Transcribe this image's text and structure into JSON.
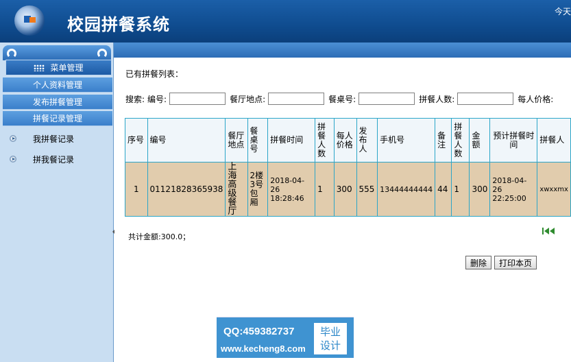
{
  "header": {
    "title": "校园拼餐系统",
    "today_label": "今天"
  },
  "sidebar": {
    "menu_title": "菜单管理",
    "sub_items": [
      "个人资料管理",
      "发布拼餐管理",
      "拼餐记录管理"
    ],
    "nav_items": [
      "我拼餐记录",
      "拼我餐记录"
    ]
  },
  "main": {
    "list_title": "已有拼餐列表：",
    "search": {
      "label": "搜索:",
      "fields": [
        {
          "label": "编号:",
          "value": ""
        },
        {
          "label": "餐厅地点:",
          "value": ""
        },
        {
          "label": "餐桌号:",
          "value": ""
        },
        {
          "label": "拼餐人数:",
          "value": ""
        },
        {
          "label": "每人价格:",
          "value": ""
        }
      ]
    },
    "table": {
      "headers": [
        "序号",
        "编号",
        "餐厅地点",
        "餐桌号",
        "拼餐时间",
        "拼餐人数",
        "每人价格",
        "发布人",
        "手机号",
        "备注",
        "拼餐人数",
        "金额",
        "预计拼餐时间",
        "拼餐人"
      ],
      "rows": [
        [
          "1",
          "01121828365938",
          "上海高级餐厅",
          "2楼3号包厢",
          "2018-04-26 18:28:46",
          "1",
          "300",
          "555",
          "13444444444",
          "44",
          "1",
          "300",
          "2018-04-26 22:25:00",
          "xwxxmx"
        ]
      ]
    },
    "total": "共计金额:300.0；",
    "buttons": {
      "delete": "删除",
      "print": "打印本页"
    }
  },
  "watermark": {
    "qq": "QQ:459382737",
    "url": "www.kecheng8.com",
    "badge_line1": "毕业",
    "badge_line2": "设计"
  },
  "colors": {
    "header": "#0f4c8f",
    "sidebar": "#c9def2",
    "table_row": "#e1ccad",
    "table_border": "#2aa5c8"
  }
}
